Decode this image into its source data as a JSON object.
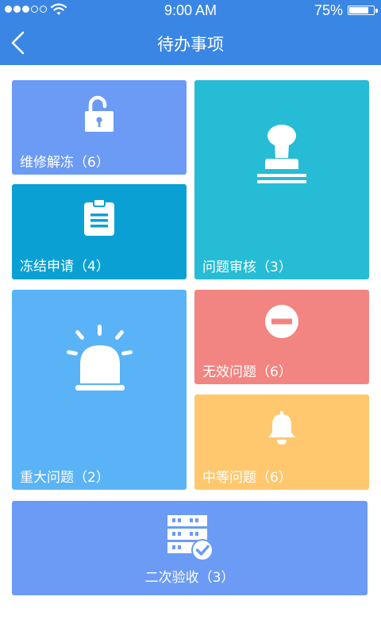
{
  "status_bar": {
    "time": "9:00 AM",
    "battery": "75%",
    "battery_level": 0.75,
    "signal_strength": 3,
    "icons": [
      "signal-dots-icon",
      "wifi-icon",
      "battery-icon"
    ]
  },
  "nav": {
    "title": "待办事项",
    "back_icon": "chevron-left-icon"
  },
  "colors": {
    "nav_bar": "#3a86e4",
    "maintenance_unfreeze": "#6c9bf5",
    "question_review": "#26bcd5",
    "freeze_request": "#0aa0d4",
    "major_issue": "#5ab3f6",
    "invalid_issue": "#f28481",
    "medium_issue": "#ffc86e",
    "secondary_acceptance": "#6c9bf5"
  },
  "tiles": {
    "maintenance_unfreeze": {
      "label": "维修解冻（6）",
      "icon": "unlocked-padlock-icon"
    },
    "question_review": {
      "label": "问题审核（3）",
      "icon": "stamp-icon"
    },
    "freeze_request": {
      "label": "冻结申请（4）",
      "icon": "clipboard-icon"
    },
    "major_issue": {
      "label": "重大问题（2）",
      "icon": "alarm-siren-icon"
    },
    "invalid_issue": {
      "label": "无效问题（6）",
      "icon": "no-entry-icon"
    },
    "medium_issue": {
      "label": "中等问题（6）",
      "icon": "bell-icon"
    },
    "secondary_acceptance": {
      "label": "二次验收（3）",
      "icon": "server-check-icon"
    }
  }
}
